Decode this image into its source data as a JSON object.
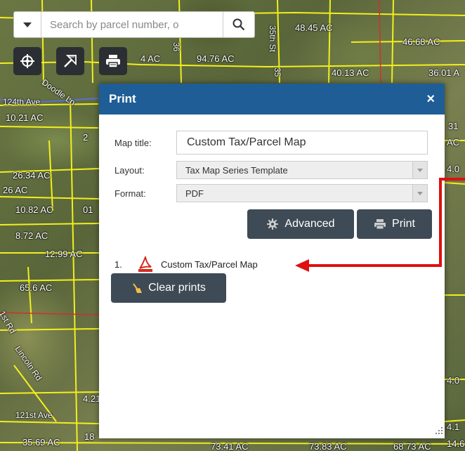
{
  "search": {
    "placeholder": "Search by parcel number, o"
  },
  "map": {
    "acreage_labels": [
      "48.45 AC",
      "46.68 AC",
      "36.01 A",
      "40.13 AC",
      "94.76 AC",
      "4 AC",
      "10.21 AC",
      "2",
      "26.34 AC",
      "26 AC",
      "10.82 AC",
      "01",
      "8.72 AC",
      "12.99 AC",
      "65.6 AC",
      "4.21",
      "35.69 AC",
      "18",
      "4.0",
      "4.0",
      "4.1",
      "14.6",
      "AC",
      "31",
      "73.41 AC",
      "73.83 AC",
      "68 73 AC"
    ],
    "road_labels": [
      "124th Ave",
      "35th St",
      "36",
      "35",
      "121st Ave",
      "Lincoln Rd",
      "1st Rd",
      "Doodle Ln"
    ]
  },
  "toolbar": {
    "tools": [
      {
        "name": "measure-tool-button",
        "icon": "measure-icon"
      },
      {
        "name": "draw-tool-button",
        "icon": "draw-icon"
      },
      {
        "name": "print-tool-button",
        "icon": "printer-icon"
      }
    ]
  },
  "print_dialog": {
    "title": "Print",
    "close_label": "×",
    "map_title_label": "Map title:",
    "map_title_value": "Custom Tax/Parcel Map",
    "layout_label": "Layout:",
    "layout_value": "Tax Map Series Template",
    "format_label": "Format:",
    "format_value": "PDF",
    "advanced_label": "Advanced",
    "print_label": "Print",
    "results": [
      {
        "index": "1.",
        "name": "Custom Tax/Parcel Map",
        "icon": "pdf-icon"
      }
    ],
    "clear_label": "Clear prints"
  },
  "colors": {
    "dialog_header": "#1f5d96",
    "button": "#3e4a56",
    "parcel_lines": "#f2ef1e",
    "annotation_arrow": "#e01010"
  }
}
